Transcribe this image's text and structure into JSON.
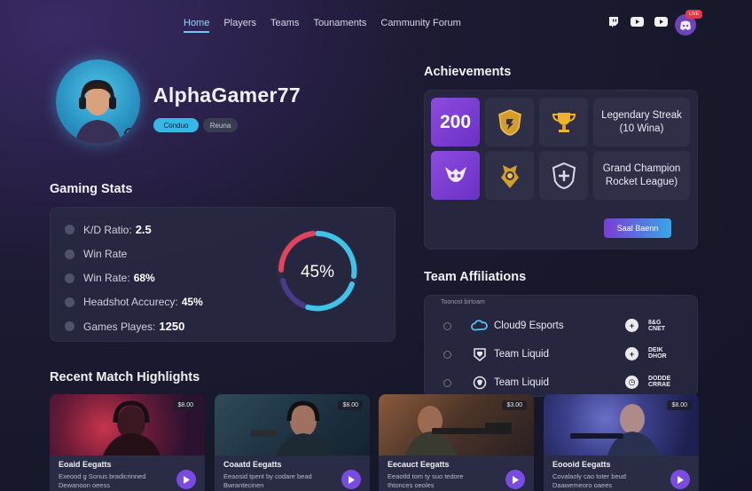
{
  "nav": {
    "items": [
      {
        "label": "Home",
        "active": true
      },
      {
        "label": "Players"
      },
      {
        "label": "Teams"
      },
      {
        "label": "Tounaments"
      },
      {
        "label": "Cammunity Forum"
      }
    ]
  },
  "header": {
    "social_icons": [
      "twitch-icon",
      "youtube-icon",
      "youtube-icon"
    ],
    "notification_badge": "LIVE"
  },
  "profile": {
    "username": "AlphaGamer77",
    "tag_primary": "Conduo",
    "tag_secondary": "Reuna"
  },
  "stats": {
    "title": "Gaming Stats",
    "rows": [
      {
        "label": "K/D Ratio:",
        "value": "2.5"
      },
      {
        "label": "Win Rate",
        "value": ""
      },
      {
        "label": "Win Rate:",
        "value": "68%"
      },
      {
        "label": "Headshot Accurecy:",
        "value": "45%"
      },
      {
        "label": "Games Playes:",
        "value": "1250"
      }
    ],
    "ring_value": "45%",
    "ring_fraction": 0.45
  },
  "achievements": {
    "title": "Achievements",
    "score": "200",
    "items": [
      {
        "line1": "Legendary Streak",
        "line2": "(10 Wina)"
      },
      {
        "line1": "Grand Champion",
        "line2": "Rocket League)"
      }
    ],
    "button_label": "Saal Baenn"
  },
  "teams": {
    "title": "Team Affiliations",
    "subtitle": "Toonost birtoam",
    "rows": [
      {
        "name": "Cloud9 Esports",
        "badge_text_1": "8&G",
        "badge_text_2": "CNET"
      },
      {
        "name": "Team Liquid",
        "badge_text_1": "DEIK",
        "badge_text_2": "DHOR"
      },
      {
        "name": "Team Liquid",
        "badge_text_1": "DODDE",
        "badge_text_2": "CRRAE"
      }
    ]
  },
  "highlights": {
    "title": "Recent Match Highlights",
    "cards": [
      {
        "title": "Eoaid Eegatts",
        "sub1": "Exeood g Sonus bradicrinned",
        "sub2": "Dewanoon oeess",
        "price": "$8.00"
      },
      {
        "title": "Coaatd Eegatts",
        "sub1": "Eeaosid tpent by codare bead",
        "sub2": "Bwrantecinen",
        "price": "$8.00"
      },
      {
        "title": "Eecauct Eegatts",
        "sub1": "Eeaotld tom ty suo tedore",
        "sub2": "Ihtonces oeoles",
        "price": "$3.00"
      },
      {
        "title": "Eoooid Eegatts",
        "sub1": "Covalaoly cao toter beud",
        "sub2": "Daawemeoro oaees",
        "price": "$8.00"
      }
    ]
  },
  "colors": {
    "accent_cyan": "#37b7e6",
    "accent_purple": "#7a3dd6",
    "ring_red": "#e0445a",
    "ring_cyan": "#3fc3e8"
  }
}
